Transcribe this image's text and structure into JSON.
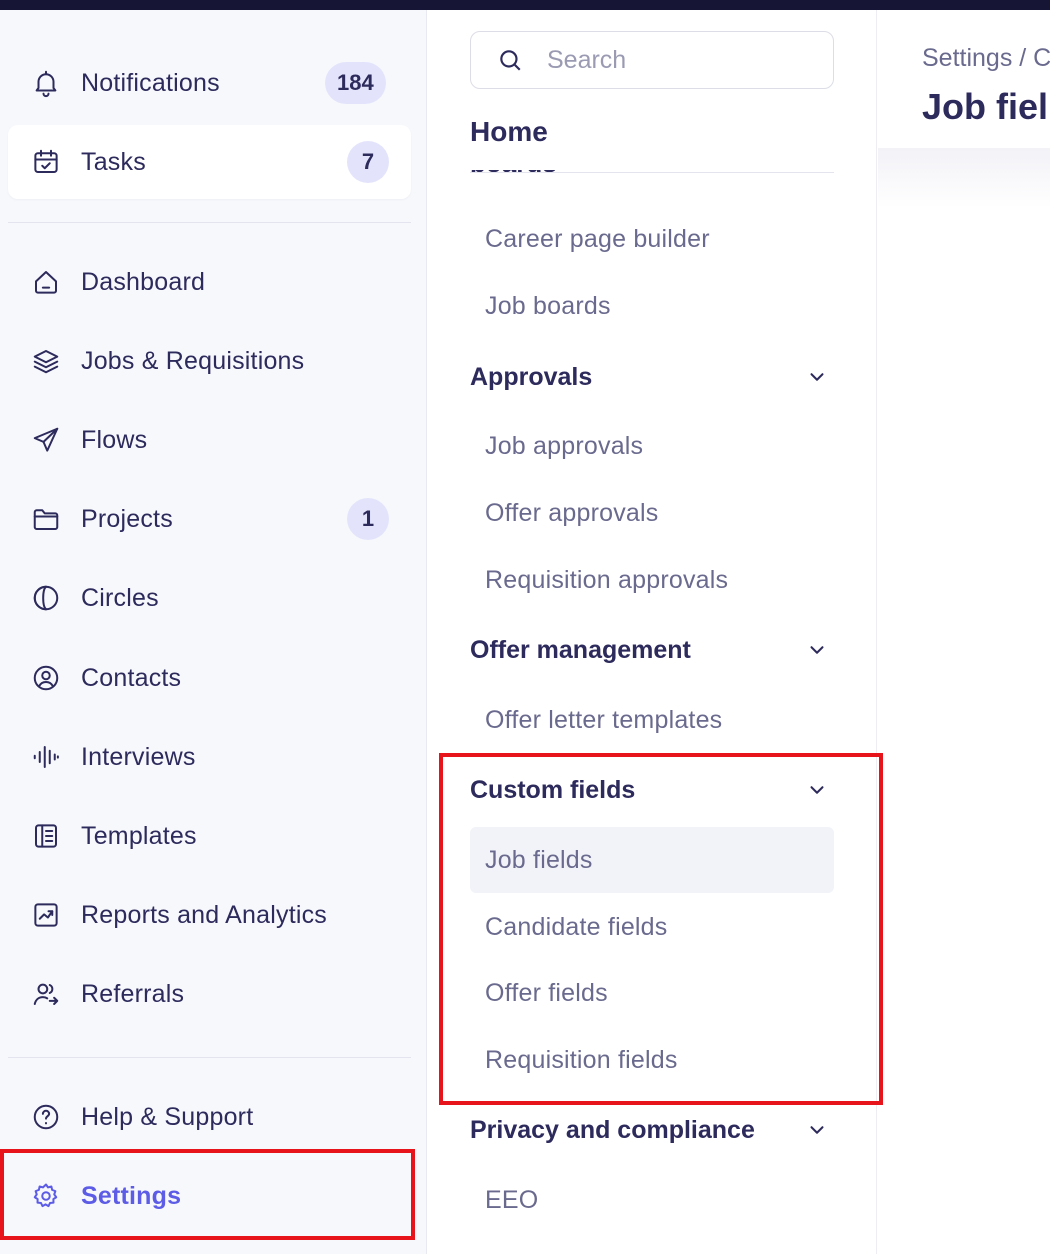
{
  "sidebar": {
    "notifications": {
      "label": "Notifications",
      "badge": "184"
    },
    "tasks": {
      "label": "Tasks",
      "badge": "7"
    },
    "items": [
      {
        "label": "Dashboard",
        "icon": "home-icon"
      },
      {
        "label": "Jobs & Requisitions",
        "icon": "layers-icon"
      },
      {
        "label": "Flows",
        "icon": "send-icon"
      },
      {
        "label": "Projects",
        "icon": "folder-icon",
        "badge": "1"
      },
      {
        "label": "Circles",
        "icon": "circles-icon"
      },
      {
        "label": "Contacts",
        "icon": "user-circle-icon"
      },
      {
        "label": "Interviews",
        "icon": "audio-wave-icon"
      },
      {
        "label": "Templates",
        "icon": "template-icon"
      },
      {
        "label": "Reports and Analytics",
        "icon": "chart-line-icon"
      },
      {
        "label": "Referrals",
        "icon": "user-share-icon"
      }
    ],
    "help": {
      "label": "Help & Support",
      "icon": "help-circle-icon"
    },
    "settings": {
      "label": "Settings",
      "icon": "gear-icon"
    }
  },
  "settings_nav": {
    "search": {
      "placeholder": "Search",
      "value": ""
    },
    "home_title": "Home",
    "clipped_heading": "boards",
    "career_items": [
      "Career page builder",
      "Job boards"
    ],
    "sections": [
      {
        "title": "Approvals",
        "items": [
          "Job approvals",
          "Offer approvals",
          "Requisition approvals"
        ]
      },
      {
        "title": "Offer management",
        "items": [
          "Offer letter templates"
        ]
      },
      {
        "title": "Custom fields",
        "items": [
          "Job fields",
          "Candidate fields",
          "Offer fields",
          "Requisition fields"
        ]
      },
      {
        "title": "Privacy and compliance",
        "items": [
          "EEO"
        ]
      }
    ],
    "selected_item": "Job fields"
  },
  "main": {
    "breadcrumb": "Settings / C",
    "title": "Job fiel"
  },
  "colors": {
    "accent": "#5c5ce6",
    "text": "#2d2a5c",
    "badge_bg": "#e3e4fb",
    "highlight": "#e8141c",
    "topbar": "#161535"
  }
}
